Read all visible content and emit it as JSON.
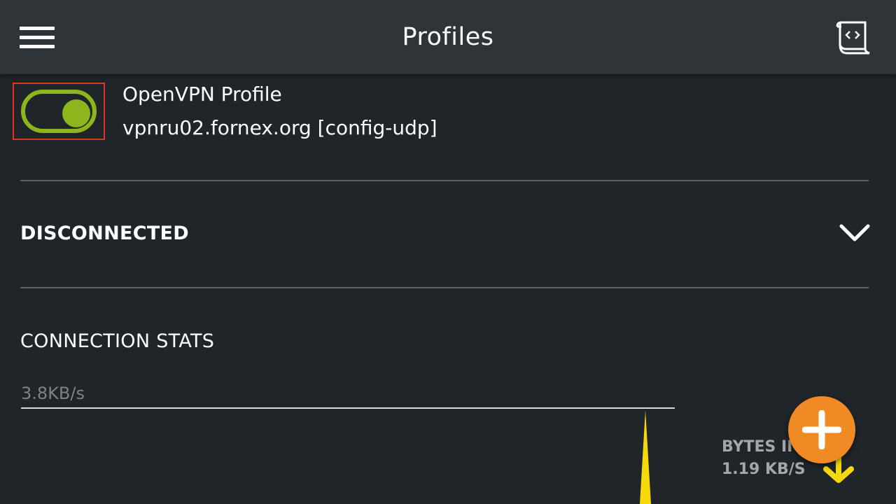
{
  "header": {
    "title": "Profiles",
    "menu_icon": "hamburger-menu-icon",
    "import_icon": "import-profile-icon"
  },
  "profile": {
    "name": "OpenVPN Profile",
    "server": "vpnru02.fornex.org [config-udp]",
    "toggle_on": true,
    "toggle_color": "#8db51c",
    "highlight_color": "#e0341f"
  },
  "status": {
    "text": "DISCONNECTED",
    "expand_icon": "chevron-down-icon"
  },
  "stats": {
    "title": "CONNECTION STATS",
    "rate_label": "3.8KB/s",
    "bytes_in_label": "BYTES IN",
    "bytes_in_value": "1.19 KB/S",
    "graph_color": "#f5d90a"
  },
  "fab": {
    "icon": "plus-icon",
    "color": "#f08a24"
  }
}
